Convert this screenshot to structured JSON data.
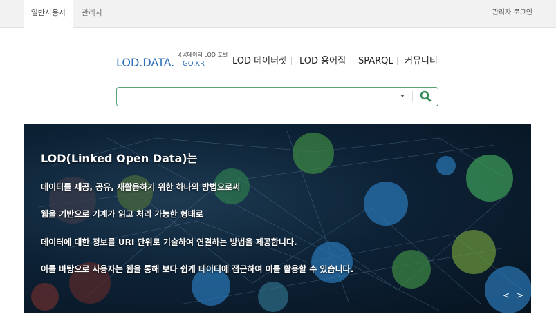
{
  "topbar": {
    "tabs": [
      {
        "label": "일반사용자",
        "active": true
      },
      {
        "label": "관리자",
        "active": false
      }
    ],
    "admin_login": "관리자 로그인"
  },
  "logo": {
    "main": "LOD.DATA.",
    "kr": "GO.KR",
    "subtitle": "공공데이터 LOD 포털"
  },
  "nav": {
    "items": [
      "LOD 데이터셋",
      "LOD 용어집",
      "SPARQL",
      "커뮤니티"
    ]
  },
  "search": {
    "value": "",
    "placeholder": ""
  },
  "hero": {
    "lines": [
      "LOD(Linked Open Data)는",
      "데이터를 제공, 공유, 재활용하기 위한 하나의 방법으로써",
      "웹을 기반으로 기계가 읽고 처리 가능한 형태로",
      "데이터에 대한 정보를 URI 단위로 기술하여 연결하는 방법을 제공합니다.",
      "이를 바탕으로 사용자는 웹을 통해 보다 쉽게 데이터에 접근하여 이를 활용할 수 있습니다."
    ],
    "prev": "<",
    "next": ">"
  },
  "colors": {
    "accent_green": "#5aa473",
    "logo_blue": "#2d6fb8"
  }
}
